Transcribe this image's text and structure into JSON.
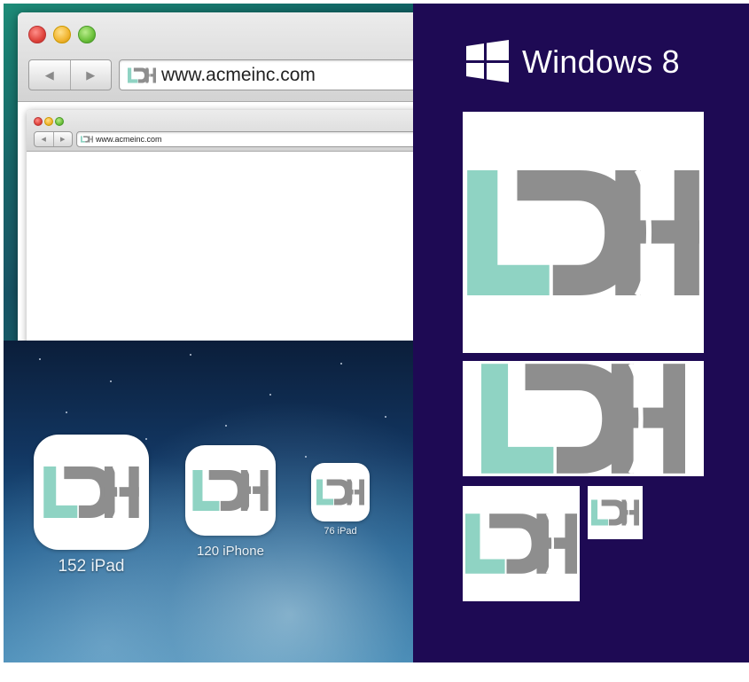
{
  "mac_browser": {
    "url": "www.acmeinc.com",
    "back_glyph": "◀",
    "forward_glyph": "▶"
  },
  "mini_browser": {
    "url": "www.acmeinc.com",
    "back_glyph": "◀",
    "forward_glyph": "▶"
  },
  "ios_icons": [
    {
      "label": "152 iPad"
    },
    {
      "label": "120 iPhone"
    },
    {
      "label": "76 iPad"
    }
  ],
  "windows": {
    "title": "Windows 8"
  },
  "logo": {
    "letters": "LDH",
    "teal": "#8fd3c3",
    "gray": "#8e8e8e"
  },
  "colors": {
    "windows_bg": "#1e0a54",
    "tile_bg": "#ffffff"
  }
}
